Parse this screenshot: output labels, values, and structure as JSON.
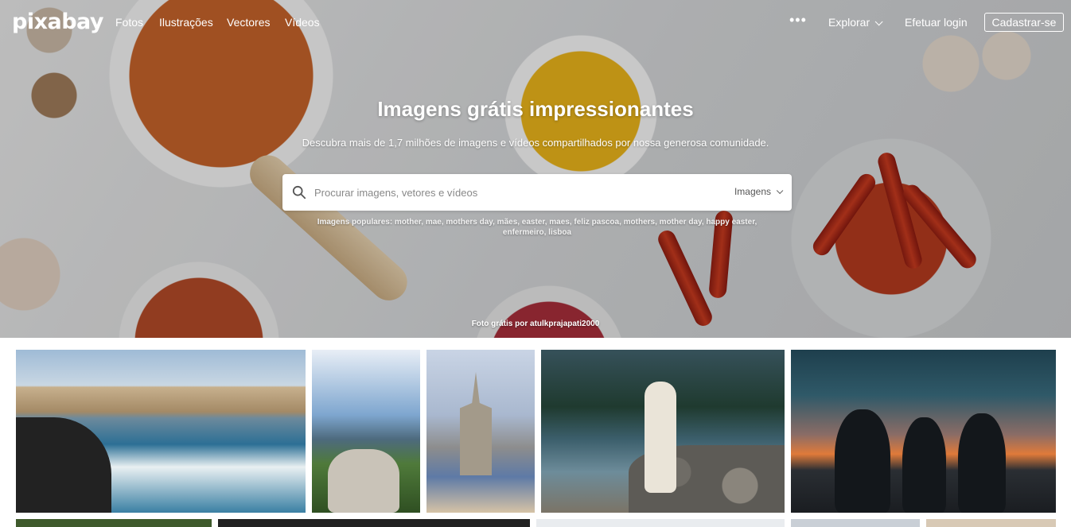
{
  "brand": {
    "logo_text": "pixabay"
  },
  "nav": {
    "links": [
      "Fotos",
      "Ilustrações",
      "Vectores",
      "Vídeos"
    ],
    "more_label": "•••",
    "explore_label": "Explorar",
    "login_label": "Efetuar login",
    "signup_label": "Cadastrar-se"
  },
  "hero": {
    "title": "Imagens grátis impressionantes",
    "subtitle": "Descubra mais de 1,7 milhões de imagens e vídeos compartilhados por nossa generosa comunidade.",
    "search": {
      "placeholder": "Procurar imagens, vetores e vídeos",
      "type_label": "Imagens"
    },
    "popular_text": "Imagens populares: mother, mae, mothers day, mães, easter, maes, feliz pascoa, mothers, mother day, happy easter, enfermeiro, lisboa",
    "credit": "Foto grátis por atulkprajapati2000"
  },
  "icons": {
    "search": "search-icon",
    "explore_chevron": "chevron-down-icon",
    "type_chevron": "chevron-down-icon",
    "more": "more-dots-icon"
  },
  "colors": {
    "hero_text": "#ffffff",
    "search_bg": "#ffffff",
    "placeholder": "#888888"
  }
}
